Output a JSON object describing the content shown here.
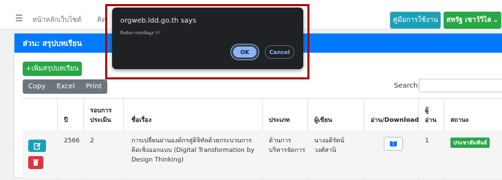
{
  "nav": {
    "menu_icon": "hamburger-icon",
    "links": [
      "หน้าหลักเว็บไซต์",
      "คิด"
    ],
    "manual_button": "คู่มือการใช้งาน",
    "user_button": "สหรัฐ เชาว์วิไล"
  },
  "panel": {
    "title": "ส่วน: สรุปบทเรียน",
    "add_button": "+เพิ่มสรุปบทเรียน",
    "export_buttons": [
      "Copy",
      "Excel",
      "Print"
    ],
    "search_label": "Search:"
  },
  "table": {
    "headers": [
      "ปี",
      "รอบการ",
      "ประเมิน",
      "ชื่อเรื่อง",
      "ประเภท",
      "ผู้เขียน",
      "อ่าน/Download",
      "ผู้",
      "อ่าน",
      "สถานะ"
    ],
    "row": {
      "year": "2566",
      "round": "2",
      "title_lines": [
        "การเปลี่ยนผ่านองค์กรสู่ดิจิทัลด้วยกระบวนการ",
        "คิดเชิงออกแบบ (Digital Transformation by",
        "Design Thinking)"
      ],
      "type_lines": [
        "ด้านการ",
        "บริหารจัดการ"
      ],
      "author_lines": [
        "นางอดิรัตน์",
        "วงศ์สานิ"
      ],
      "readers": "1",
      "status": "ประชาสัมพันธ์"
    }
  },
  "dialog": {
    "title": "orgweb.ldd.go.th says",
    "message": "ยืนยันการลบข้อมูล !!!",
    "ok_label": "OK",
    "cancel_label": "Cancel"
  },
  "colors": {
    "primary": "#007bff",
    "success": "#28a745",
    "info": "#17a2b8",
    "danger": "#dc3545",
    "highlight_frame": "#aa0000"
  }
}
